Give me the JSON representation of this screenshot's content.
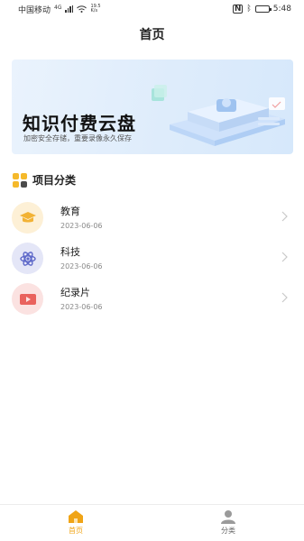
{
  "status_bar": {
    "carrier": "中国移动",
    "network": "4G",
    "speed_value": "19.5",
    "speed_unit": "K/s",
    "time": "5:48",
    "battery_level": 0.3
  },
  "header": {
    "title": "首页"
  },
  "banner": {
    "title": "知识付费云盘",
    "subtitle": "加密安全存储，重要录像永久保存"
  },
  "section": {
    "title": "项目分类",
    "icon": "grid-icon"
  },
  "categories": [
    {
      "name": "教育",
      "date": "2023-06-06",
      "icon": "graduation-cap-icon",
      "bg": "#fdf0d6",
      "color": "#f2b234"
    },
    {
      "name": "科技",
      "date": "2023-06-06",
      "icon": "atom-icon",
      "bg": "#e4e6f7",
      "color": "#5d68c9"
    },
    {
      "name": "纪录片",
      "date": "2023-06-06",
      "icon": "video-icon",
      "bg": "#fbe2e1",
      "color": "#e9625d"
    }
  ],
  "tab_bar": {
    "tabs": [
      {
        "label": "首页",
        "icon": "home-icon",
        "active": true
      },
      {
        "label": "分类",
        "icon": "user-icon",
        "active": false
      }
    ],
    "active_color": "#f0a416",
    "inactive_color": "#9a9a9a"
  }
}
